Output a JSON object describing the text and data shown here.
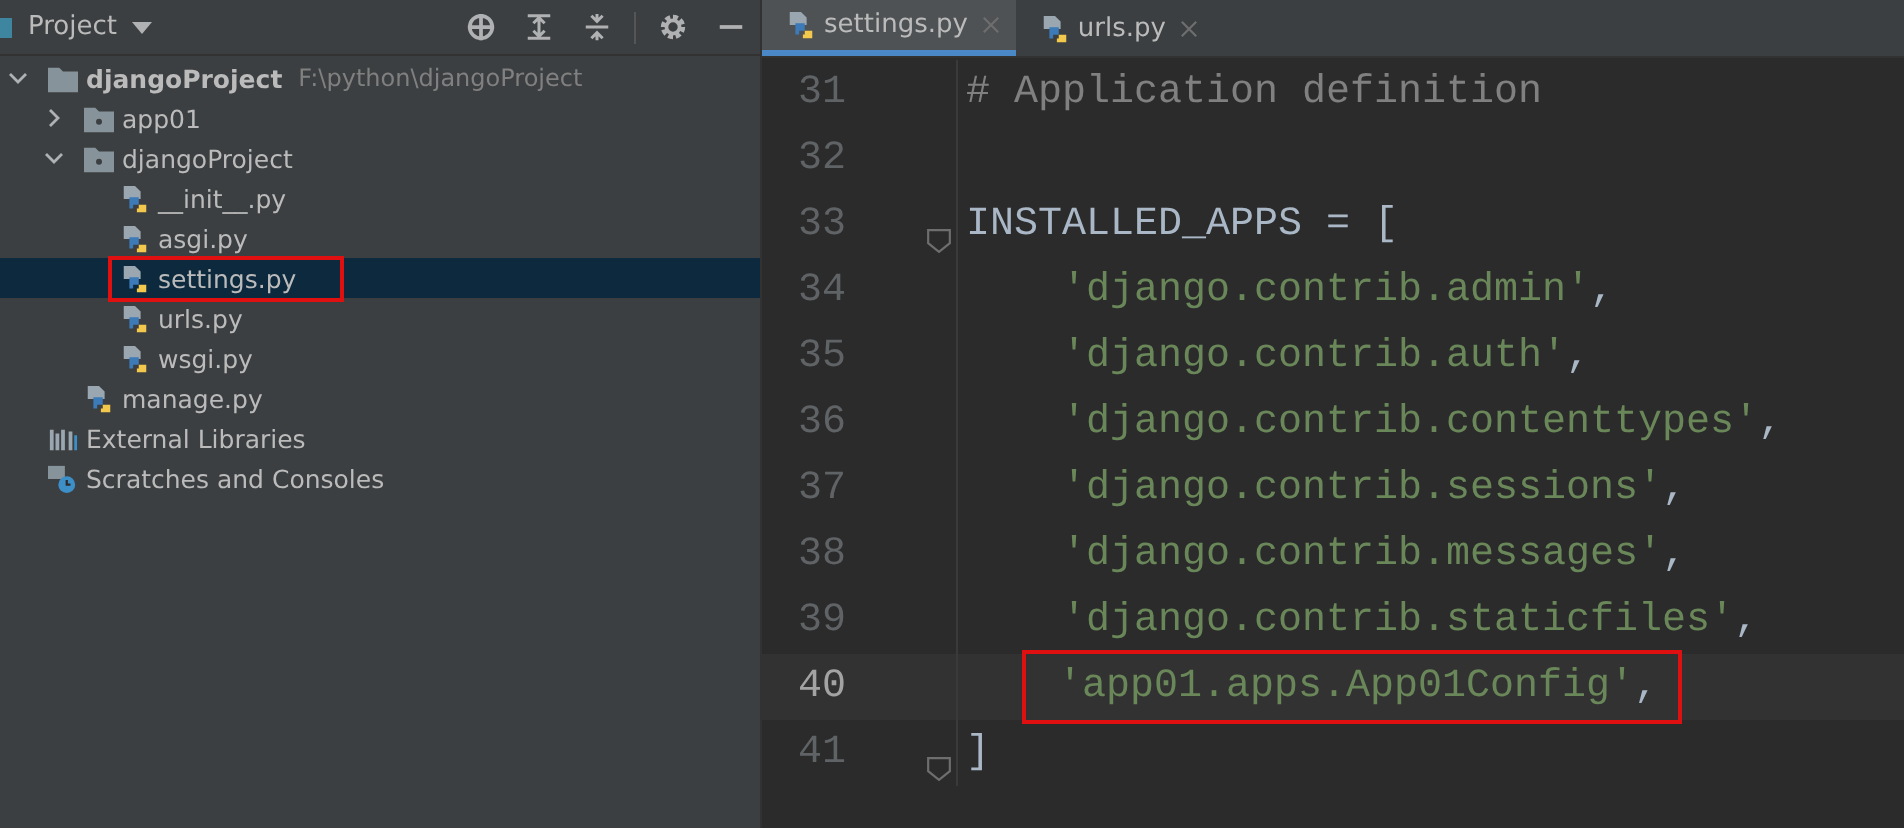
{
  "project_panel": {
    "title": "Project",
    "tree": [
      {
        "label": "djangoProject",
        "hint": "F:\\python\\djangoProject",
        "kind": "root",
        "expanded": true,
        "selected": false,
        "highlighted": false,
        "children": [
          {
            "label": "app01",
            "kind": "folder",
            "expanded": false,
            "selected": false,
            "highlighted": false
          },
          {
            "label": "djangoProject",
            "kind": "folder",
            "expanded": true,
            "selected": false,
            "highlighted": false,
            "children": [
              {
                "label": "__init__.py",
                "kind": "python",
                "selected": false,
                "highlighted": false
              },
              {
                "label": "asgi.py",
                "kind": "python",
                "selected": false,
                "highlighted": false
              },
              {
                "label": "settings.py",
                "kind": "python",
                "selected": true,
                "highlighted": true
              },
              {
                "label": "urls.py",
                "kind": "python",
                "selected": false,
                "highlighted": false
              },
              {
                "label": "wsgi.py",
                "kind": "python",
                "selected": false,
                "highlighted": false
              }
            ]
          },
          {
            "label": "manage.py",
            "kind": "python",
            "selected": false,
            "highlighted": false
          }
        ]
      },
      {
        "label": "External Libraries",
        "kind": "libraries",
        "selected": false,
        "highlighted": false
      },
      {
        "label": "Scratches and Consoles",
        "kind": "scratches",
        "selected": false,
        "highlighted": false
      }
    ]
  },
  "editor": {
    "tabs": [
      {
        "label": "settings.py",
        "selected": true
      },
      {
        "label": "urls.py",
        "selected": false
      }
    ],
    "lines": [
      {
        "number": "31",
        "fold": false,
        "current": false,
        "highlighted": false,
        "indented": false,
        "tokens": [
          {
            "text": "# Application definition",
            "kind": "comment"
          }
        ]
      },
      {
        "number": "32",
        "fold": false,
        "current": false,
        "highlighted": false,
        "indented": false
      },
      {
        "number": "33",
        "fold": true,
        "current": false,
        "highlighted": false,
        "indented": false,
        "tokens": [
          {
            "text": "INSTALLED_APPS = [",
            "kind": "plain"
          }
        ]
      },
      {
        "number": "34",
        "fold": false,
        "current": false,
        "highlighted": false,
        "indented": true,
        "tokens": [
          {
            "text": "'django.contrib.admin'",
            "kind": "string"
          },
          {
            "text": ",",
            "kind": "plain"
          }
        ]
      },
      {
        "number": "35",
        "fold": false,
        "current": false,
        "highlighted": false,
        "indented": true,
        "tokens": [
          {
            "text": "'django.contrib.auth'",
            "kind": "string"
          },
          {
            "text": ",",
            "kind": "plain"
          }
        ]
      },
      {
        "number": "36",
        "fold": false,
        "current": false,
        "highlighted": false,
        "indented": true,
        "tokens": [
          {
            "text": "'django.contrib.contenttypes'",
            "kind": "string"
          },
          {
            "text": ",",
            "kind": "plain"
          }
        ]
      },
      {
        "number": "37",
        "fold": false,
        "current": false,
        "highlighted": false,
        "indented": true,
        "tokens": [
          {
            "text": "'django.contrib.sessions'",
            "kind": "string"
          },
          {
            "text": ",",
            "kind": "plain"
          }
        ]
      },
      {
        "number": "38",
        "fold": false,
        "current": false,
        "highlighted": false,
        "indented": true,
        "tokens": [
          {
            "text": "'django.contrib.messages'",
            "kind": "string"
          },
          {
            "text": ",",
            "kind": "plain"
          }
        ]
      },
      {
        "number": "39",
        "fold": false,
        "current": false,
        "highlighted": false,
        "indented": true,
        "tokens": [
          {
            "text": "'django.contrib.staticfiles'",
            "kind": "string"
          },
          {
            "text": ",",
            "kind": "plain"
          }
        ]
      },
      {
        "number": "40",
        "fold": false,
        "current": true,
        "highlighted": true,
        "indented": true,
        "tokens": [
          {
            "text": "'app01.apps.App01Config'",
            "kind": "string"
          },
          {
            "text": ",",
            "kind": "plain"
          }
        ]
      },
      {
        "number": "41",
        "fold": true,
        "current": false,
        "highlighted": false,
        "indented": false,
        "tokens": [
          {
            "text": "]",
            "kind": "plain"
          }
        ]
      }
    ]
  }
}
